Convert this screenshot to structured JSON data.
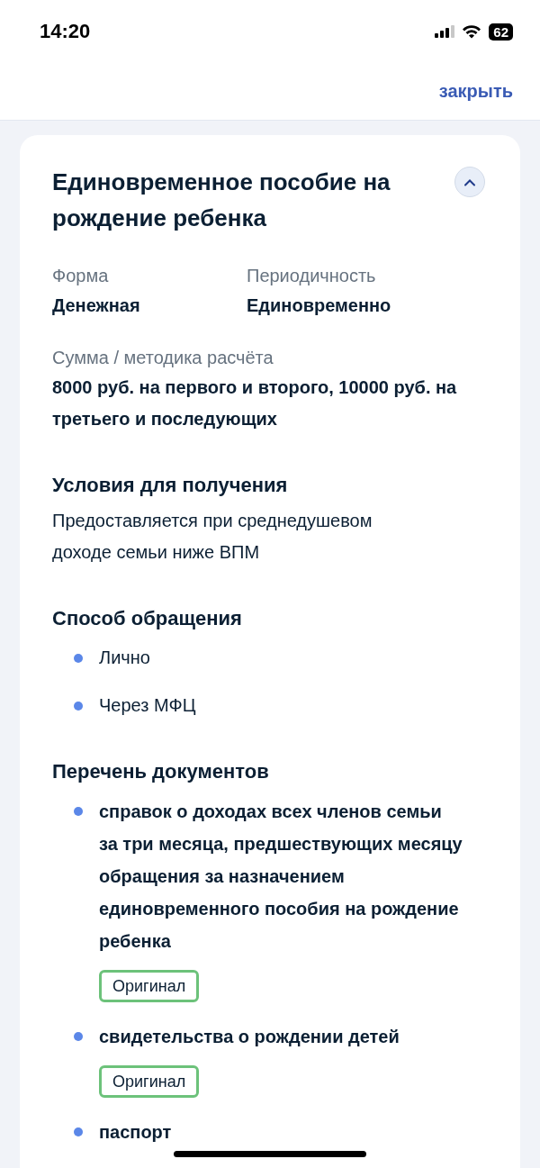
{
  "status_bar": {
    "time": "14:20",
    "battery": "62"
  },
  "header": {
    "close": "закрыть"
  },
  "card": {
    "title": "Единовременное пособие на рождение ребенка",
    "expanded": true,
    "fields": [
      {
        "label": "Форма",
        "value": "Денежная"
      },
      {
        "label": "Периодичность",
        "value": "Единовременно"
      },
      {
        "label": "Сумма / методика расчёта",
        "value": "8000 руб. на первого и второго, 10000 руб. на третьего и последующих"
      }
    ],
    "sections": [
      {
        "kind": "text",
        "title": "Условия для получения",
        "text": "Предоставляется при среднедушевом доходе семьи ниже ВПМ"
      },
      {
        "kind": "list",
        "title": "Способ обращения",
        "items": [
          {
            "text": "Лично"
          },
          {
            "text": "Через МФЦ"
          }
        ]
      },
      {
        "kind": "documents",
        "title": "Перечень документов",
        "items": [
          {
            "text": "справок о доходах всех членов семьи за три месяца, предшествующих месяцу обращения за назначением единовременного пособия на рождение ребенка",
            "tag": "Оригинал"
          },
          {
            "text": "свидетельства о рождении детей",
            "tag": "Оригинал"
          },
          {
            "text": "паспорт"
          }
        ]
      }
    ]
  }
}
